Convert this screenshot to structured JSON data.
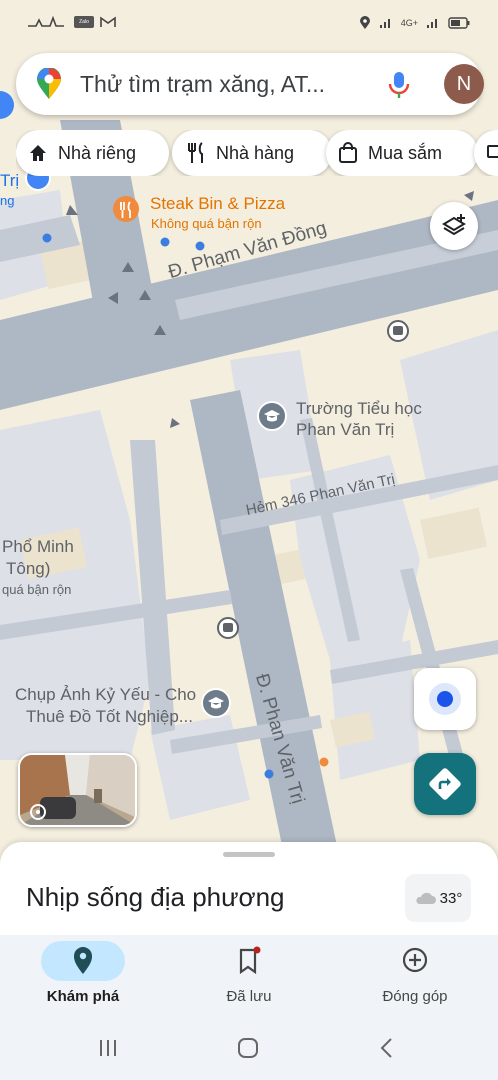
{
  "status_bar": {
    "left_chip_label": "Zalo",
    "network": "4G+"
  },
  "search": {
    "placeholder": "Thử tìm trạm xăng, AT...",
    "avatar_letter": "N"
  },
  "chips": [
    {
      "label": "Nhà riêng",
      "icon": "home-icon"
    },
    {
      "label": "Nhà hàng",
      "icon": "restaurant-icon"
    },
    {
      "label": "Mua sắm",
      "icon": "shopping-bag-icon"
    }
  ],
  "map": {
    "places": {
      "steak_title": "Steak Bin & Pizza",
      "steak_sub": "Không quá bận rộn",
      "school_line1": "Trường Tiểu học",
      "school_line2": "Phan Văn Trị",
      "pho_line1": "Phổ Minh",
      "pho_line2": "Tông)",
      "pho_sub": "quá bận rộn",
      "photo_line1": "Chụp Ảnh Kỷ Yếu - Cho",
      "photo_line2": "Thuê Đồ Tốt Nghiệp...",
      "top_left_1": "Trị",
      "top_left_2": "ng"
    },
    "streets": {
      "pham_van_dong": "Đ. Phạm Văn Đồng",
      "phan_van_tri": "Đ. Phan Văn Trị",
      "hem_346": "Hẻm 346 Phan Văn Trị"
    }
  },
  "sheet": {
    "title": "Nhịp sống địa phương",
    "weather": "33°"
  },
  "bottom_nav": [
    {
      "label": "Khám phá",
      "active": true
    },
    {
      "label": "Đã lưu",
      "active": false
    },
    {
      "label": "Đóng góp",
      "active": false
    }
  ],
  "colors": {
    "map_bg": "#f4eedf",
    "road": "#aeb8c4",
    "block": "#d8dce3",
    "accent_teal": "#14727c",
    "poi_orange": "#e37400"
  }
}
